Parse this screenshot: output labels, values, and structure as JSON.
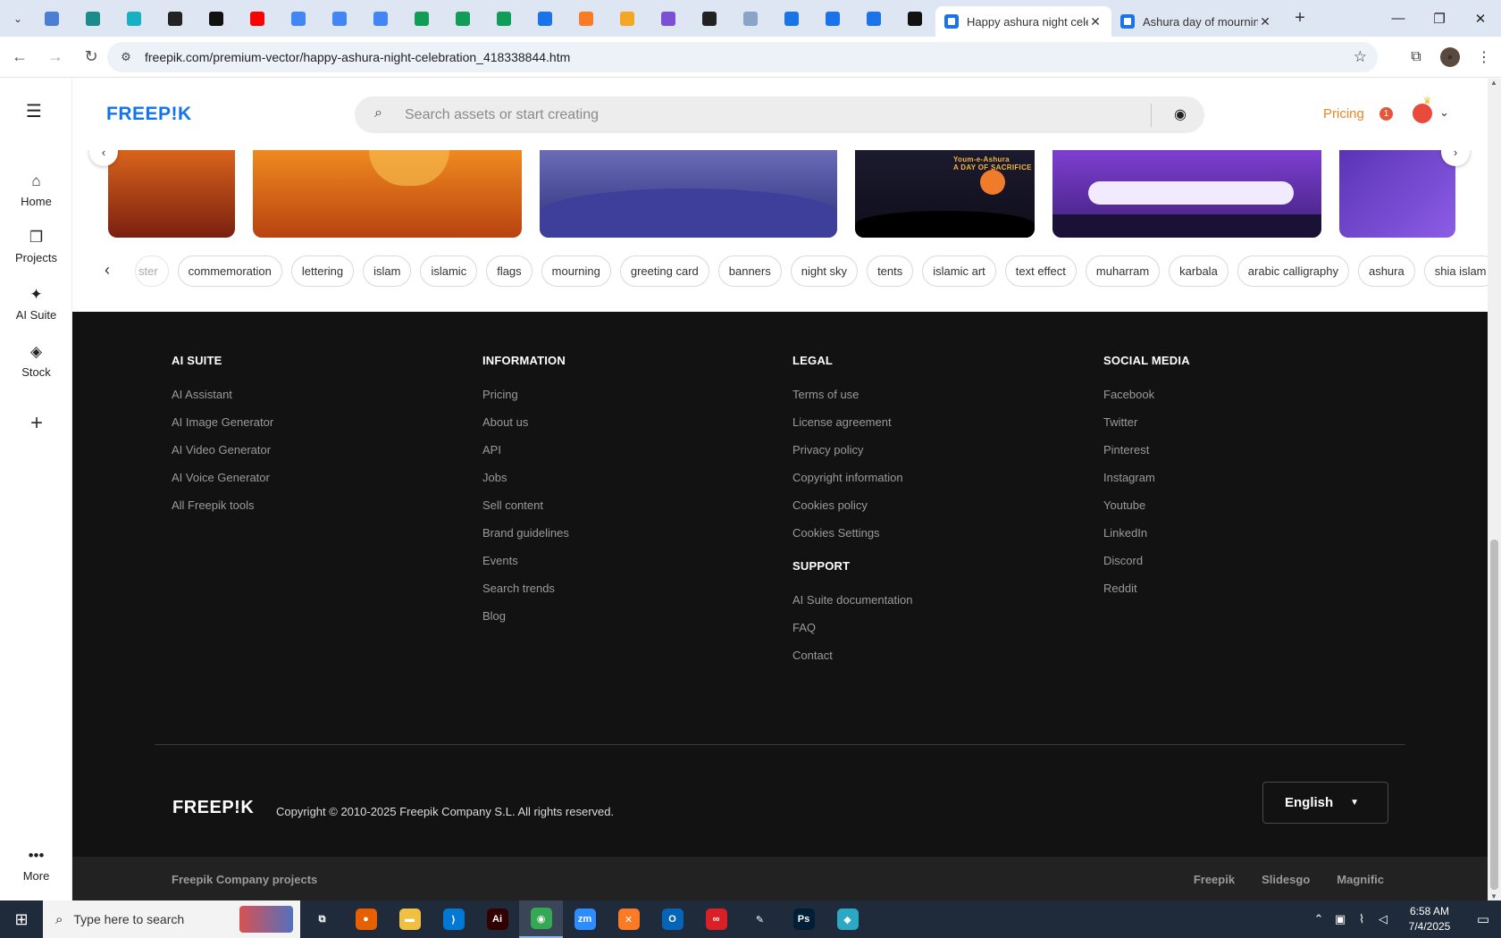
{
  "browser": {
    "pinned_tabs": [
      {
        "icon": "globe-icon",
        "color": "#4a7fd4"
      },
      {
        "icon": "shield-icon",
        "color": "#1a8c8c"
      },
      {
        "icon": "arrow-icon",
        "color": "#1ab0c4"
      },
      {
        "icon": "chatgpt-icon",
        "color": "#222222"
      },
      {
        "icon": "bolt-icon",
        "color": "#111111"
      },
      {
        "icon": "youtube-icon",
        "color": "#ff0000"
      },
      {
        "icon": "docs-icon",
        "color": "#4285f4"
      },
      {
        "icon": "docs-icon",
        "color": "#4285f4"
      },
      {
        "icon": "docs-icon",
        "color": "#4285f4"
      },
      {
        "icon": "sheets-icon",
        "color": "#0f9d58"
      },
      {
        "icon": "sheets-icon",
        "color": "#0f9d58"
      },
      {
        "icon": "sheets-icon",
        "color": "#0f9d58"
      },
      {
        "icon": "chart-icon",
        "color": "#1a73e8"
      },
      {
        "icon": "xampp-icon",
        "color": "#fb7a24"
      },
      {
        "icon": "butterfly-icon",
        "color": "#f5a623"
      },
      {
        "icon": "braces-icon",
        "color": "#7b4fd6"
      },
      {
        "icon": "lambda-icon",
        "color": "#222222"
      },
      {
        "icon": "grid-icon",
        "color": "#8aa4c8"
      },
      {
        "icon": "forms-icon",
        "color": "#1a73e8"
      },
      {
        "icon": "forms-icon",
        "color": "#1a73e8"
      },
      {
        "icon": "forms-icon",
        "color": "#1a73e8"
      },
      {
        "icon": "medium-icon",
        "color": "#111111"
      }
    ],
    "tabs": [
      {
        "title": "Happy ashura night celeb",
        "active": true
      },
      {
        "title": "Ashura day of mourning",
        "active": false
      }
    ],
    "url": "freepik.com/premium-vector/happy-ashura-night-celebration_418338844.htm"
  },
  "rail": {
    "items": [
      {
        "label": "Home",
        "icon": "home-icon"
      },
      {
        "label": "Projects",
        "icon": "projects-icon"
      },
      {
        "label": "AI Suite",
        "icon": "sparkle-icon"
      },
      {
        "label": "Stock",
        "icon": "stock-icon"
      }
    ],
    "more_label": "More"
  },
  "header": {
    "logo": "FREEP!K",
    "search_placeholder": "Search assets or start creating",
    "pricing": "Pricing",
    "notification_count": "1",
    "accent": "#e8852a"
  },
  "carousel": {
    "card4_caption_1": "Youm-e-Ashura",
    "card4_caption_2": "A DAY OF SACRIFICE"
  },
  "tags": [
    "ster",
    "commemoration",
    "lettering",
    "islam",
    "islamic",
    "flags",
    "mourning",
    "greeting card",
    "banners",
    "night sky",
    "tents",
    "islamic art",
    "text effect",
    "muharram",
    "karbala",
    "arabic calligraphy",
    "ashura",
    "shia islam"
  ],
  "footer": {
    "columns": [
      {
        "heading": "AI SUITE",
        "links": [
          "AI Assistant",
          "AI Image Generator",
          "AI Video Generator",
          "AI Voice Generator",
          "All Freepik tools"
        ]
      },
      {
        "heading": "INFORMATION",
        "links": [
          "Pricing",
          "About us",
          "API",
          "Jobs",
          "Sell content",
          "Brand guidelines",
          "Events",
          "Search trends",
          "Blog"
        ]
      },
      {
        "heading": "LEGAL",
        "links": [
          "Terms of use",
          "License agreement",
          "Privacy policy",
          "Copyright information",
          "Cookies policy",
          "Cookies Settings"
        ],
        "sub_heading": "SUPPORT",
        "sub_links": [
          "AI Suite documentation",
          "FAQ",
          "Contact"
        ]
      },
      {
        "heading": "SOCIAL MEDIA",
        "links": [
          "Facebook",
          "Twitter",
          "Pinterest",
          "Instagram",
          "Youtube",
          "LinkedIn",
          "Discord",
          "Reddit"
        ]
      }
    ],
    "logo": "FREEP!K",
    "copyright": "Copyright © 2010-2025 Freepik Company S.L. All rights reserved.",
    "language": "English",
    "projects_label": "Freepik Company projects",
    "projects": [
      "Freepik",
      "Slidesgo",
      "Magnific"
    ]
  },
  "taskbar": {
    "search_text": "Type here to search",
    "apps": [
      {
        "icon": "task-view-icon",
        "color": "#1f2a3a",
        "glyph": "⧉"
      },
      {
        "icon": "firefox-icon",
        "color": "#e66000",
        "glyph": "●"
      },
      {
        "icon": "file-explorer-icon",
        "color": "#f0c040",
        "glyph": "▬"
      },
      {
        "icon": "vscode-icon",
        "color": "#0078d4",
        "glyph": "⟩"
      },
      {
        "icon": "illustrator-icon",
        "color": "#330000",
        "glyph": "Ai"
      },
      {
        "icon": "chrome-icon",
        "color": "#34a853",
        "glyph": "◉"
      },
      {
        "icon": "zoom-icon",
        "color": "#2d8cff",
        "glyph": "zm"
      },
      {
        "icon": "xampp-icon",
        "color": "#fb7a24",
        "glyph": "✕"
      },
      {
        "icon": "outlook-icon",
        "color": "#0364b8",
        "glyph": "O"
      },
      {
        "icon": "creative-cloud-icon",
        "color": "#da1f26",
        "glyph": "∞"
      },
      {
        "icon": "pen-icon",
        "color": "#1f2a3a",
        "glyph": "✎"
      },
      {
        "icon": "photoshop-icon",
        "color": "#001e36",
        "glyph": "Ps"
      },
      {
        "icon": "app-icon",
        "color": "#2aa8c4",
        "glyph": "◆"
      }
    ],
    "time": "6:58 AM",
    "date": "7/4/2025"
  }
}
